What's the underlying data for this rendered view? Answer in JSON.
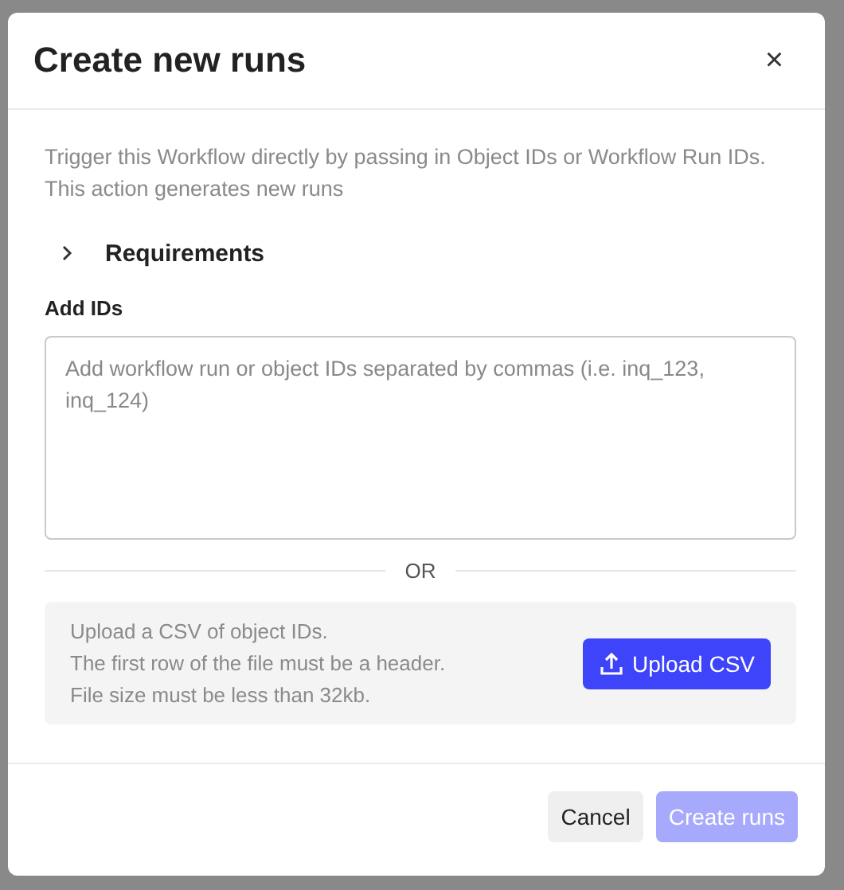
{
  "dialog": {
    "title": "Create new runs",
    "close": "×"
  },
  "description": "Trigger this Workflow directly by passing in Object IDs or Workflow Run IDs. This action generates new runs",
  "requirements": {
    "label": "Requirements",
    "expanded": false
  },
  "ids": {
    "label": "Add IDs",
    "placeholder": "Add workflow run or object IDs separated by commas (i.e. inq_123, inq_124)"
  },
  "separator": "OR",
  "upload": {
    "lines": [
      "Upload a CSV of object IDs.",
      "The first row of the file must be a header.",
      "File size must be less than 32kb."
    ],
    "button": "Upload CSV"
  },
  "footer": {
    "cancel": "Cancel",
    "submit": {
      "label": "Create runs",
      "disabled": true
    }
  }
}
